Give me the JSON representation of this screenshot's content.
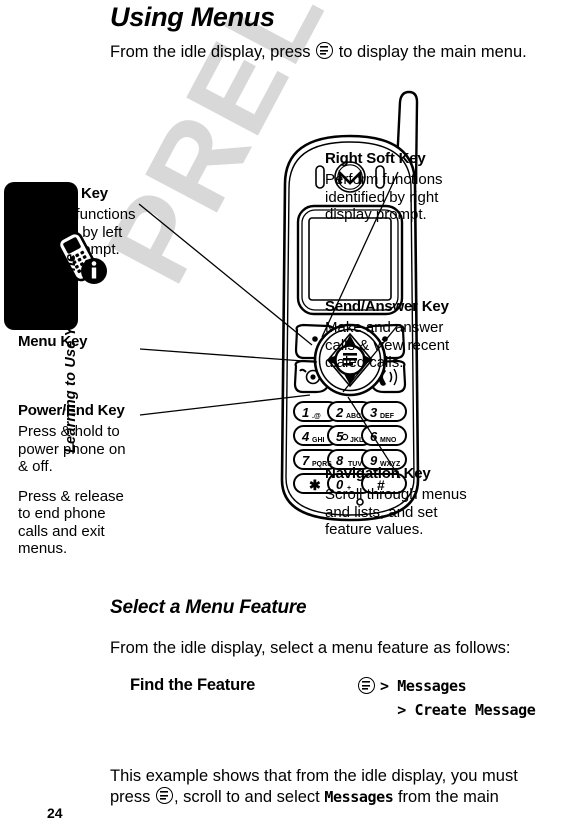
{
  "page": {
    "number": "24",
    "watermark": "PRELIMINARY"
  },
  "sidebar": {
    "section_label": "Learning to Use Your Phone",
    "tab_icon": "phone-info-icon"
  },
  "main": {
    "title": "Using Menus",
    "intro_before": "From the idle display, press ",
    "intro_icon": "menu-key-icon",
    "intro_after": " to display the main menu.",
    "subtitle": "Select a Menu Feature",
    "select_paragraph": "From the idle display, select a menu feature as follows:",
    "final_before": "This example shows that from the idle display, you must press ",
    "final_icon": "menu-key-icon",
    "final_mid": ", scroll to and select ",
    "final_mono": "Messages",
    "final_after": " from the main"
  },
  "find_the_feature": {
    "label": "Find the Feature",
    "icon": "menu-key-icon",
    "steps": [
      "> Messages",
      "  > Create Message"
    ]
  },
  "callouts": {
    "left_soft_key": {
      "heading": "Left Soft Key",
      "body": [
        "Perform functions identified by left display prompt."
      ]
    },
    "menu_key": {
      "heading": "Menu Key",
      "body": []
    },
    "power_end_key": {
      "heading": "Power/End Key",
      "body": [
        "Press & hold to power phone on & off.",
        "Press & release to end phone calls and exit menus."
      ]
    },
    "right_soft_key": {
      "heading": "Right Soft Key",
      "body": [
        "Perform functions identified by right display prompt."
      ]
    },
    "send_answer_key": {
      "heading": "Send/Answer Key",
      "body": [
        "Make and answer calls & view recent dialed calls."
      ]
    },
    "navigation_key": {
      "heading": "Navigation Key",
      "body": [
        "Scroll through menus and lists, and set feature values."
      ]
    }
  },
  "phone": {
    "brand_logo": "motorola-logo",
    "keypad": [
      {
        "digit": "1",
        "letters": ".@"
      },
      {
        "digit": "2",
        "letters": "ABC"
      },
      {
        "digit": "3",
        "letters": "DEF"
      },
      {
        "digit": "4",
        "letters": "GHI"
      },
      {
        "digit": "5",
        "letters": "JKL"
      },
      {
        "digit": "6",
        "letters": "MNO"
      },
      {
        "digit": "7",
        "letters": "PQRS"
      },
      {
        "digit": "8",
        "letters": "TUV"
      },
      {
        "digit": "9",
        "letters": "WXYZ"
      },
      {
        "digit": "*",
        "letters": ""
      },
      {
        "digit": "0",
        "letters": "+"
      },
      {
        "digit": "#",
        "letters": ""
      }
    ]
  },
  "colors": {
    "ink": "#000000",
    "watermark": "#d8d8d8",
    "paper": "#ffffff"
  }
}
